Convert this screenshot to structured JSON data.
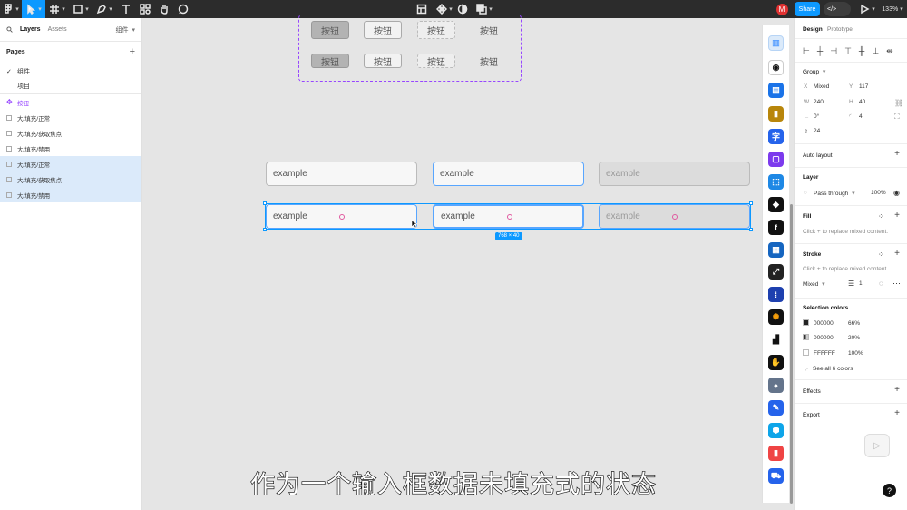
{
  "toolbar": {
    "share_label": "Share",
    "zoom": "133%",
    "avatar_letter": "M",
    "code_label": "</>"
  },
  "left_panel": {
    "tabs": [
      "Layers",
      "Assets"
    ],
    "components_dropdown": "组件",
    "pages_title": "Pages",
    "pages": [
      "组件",
      "项目"
    ],
    "layers": [
      "按钮",
      "大/填充/正常",
      "大/填充/获取焦点",
      "大/填充/禁用",
      "大/填充/正常",
      "大/填充/获取焦点",
      "大/填充/禁用"
    ]
  },
  "canvas": {
    "buttons_row1": [
      "按钮",
      "按钮",
      "按钮",
      "按钮"
    ],
    "buttons_row2": [
      "按钮",
      "按钮",
      "按钮",
      "按钮"
    ],
    "fields_row1": [
      "example",
      "example",
      "example"
    ],
    "fields_row2": [
      "example",
      "example",
      "example"
    ],
    "selection_size": "768 × 40"
  },
  "right_panel": {
    "tabs": [
      "Design",
      "Prototype"
    ],
    "group_label": "Group",
    "x_label": "X",
    "x_value": "Mixed",
    "y_label": "Y",
    "y_value": "117",
    "w_label": "W",
    "w_value": "240",
    "h_label": "H",
    "h_value": "40",
    "rotation": "0°",
    "radius": "4",
    "spacing": "24",
    "auto_layout": "Auto layout",
    "layer_title": "Layer",
    "blend_mode": "Pass through",
    "opacity": "100%",
    "fill_title": "Fill",
    "fill_hint": "Click + to replace mixed content.",
    "stroke_title": "Stroke",
    "stroke_hint": "Click + to replace mixed content.",
    "stroke_mode": "Mixed",
    "stroke_weight": "1",
    "selection_colors_title": "Selection colors",
    "selection_colors": [
      {
        "hex": "000000",
        "opacity": "66%"
      },
      {
        "hex": "000000",
        "opacity": "20%"
      },
      {
        "hex": "FFFFFF",
        "opacity": "100%"
      }
    ],
    "see_all": "See all 6 colors",
    "effects_title": "Effects",
    "export_title": "Export"
  },
  "subtitle": "作为一个输入框数据未填充式的状态",
  "colors": {
    "accent": "#0d99ff",
    "toolbar_bg": "#2c2c2c",
    "component_purple": "#9747ff",
    "avatar": "#e03131"
  }
}
